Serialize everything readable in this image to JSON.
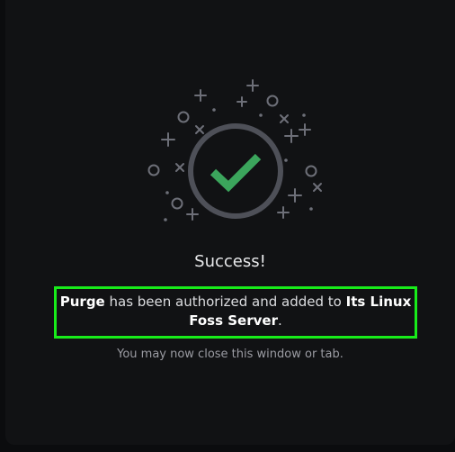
{
  "status": {
    "title": "Success!"
  },
  "message": {
    "bot_name": "Purge",
    "middle_text": " has been authorized and added to ",
    "server_name": "Its Linux Foss Server",
    "end_text": "."
  },
  "note": "You may now close this window or tab.",
  "colors": {
    "check": "#3ba55c",
    "ring": "#4e5058",
    "highlight_border": "#18ec1a",
    "background": "#111214"
  },
  "icons": {
    "illustration": "success-checkmark-icon"
  }
}
